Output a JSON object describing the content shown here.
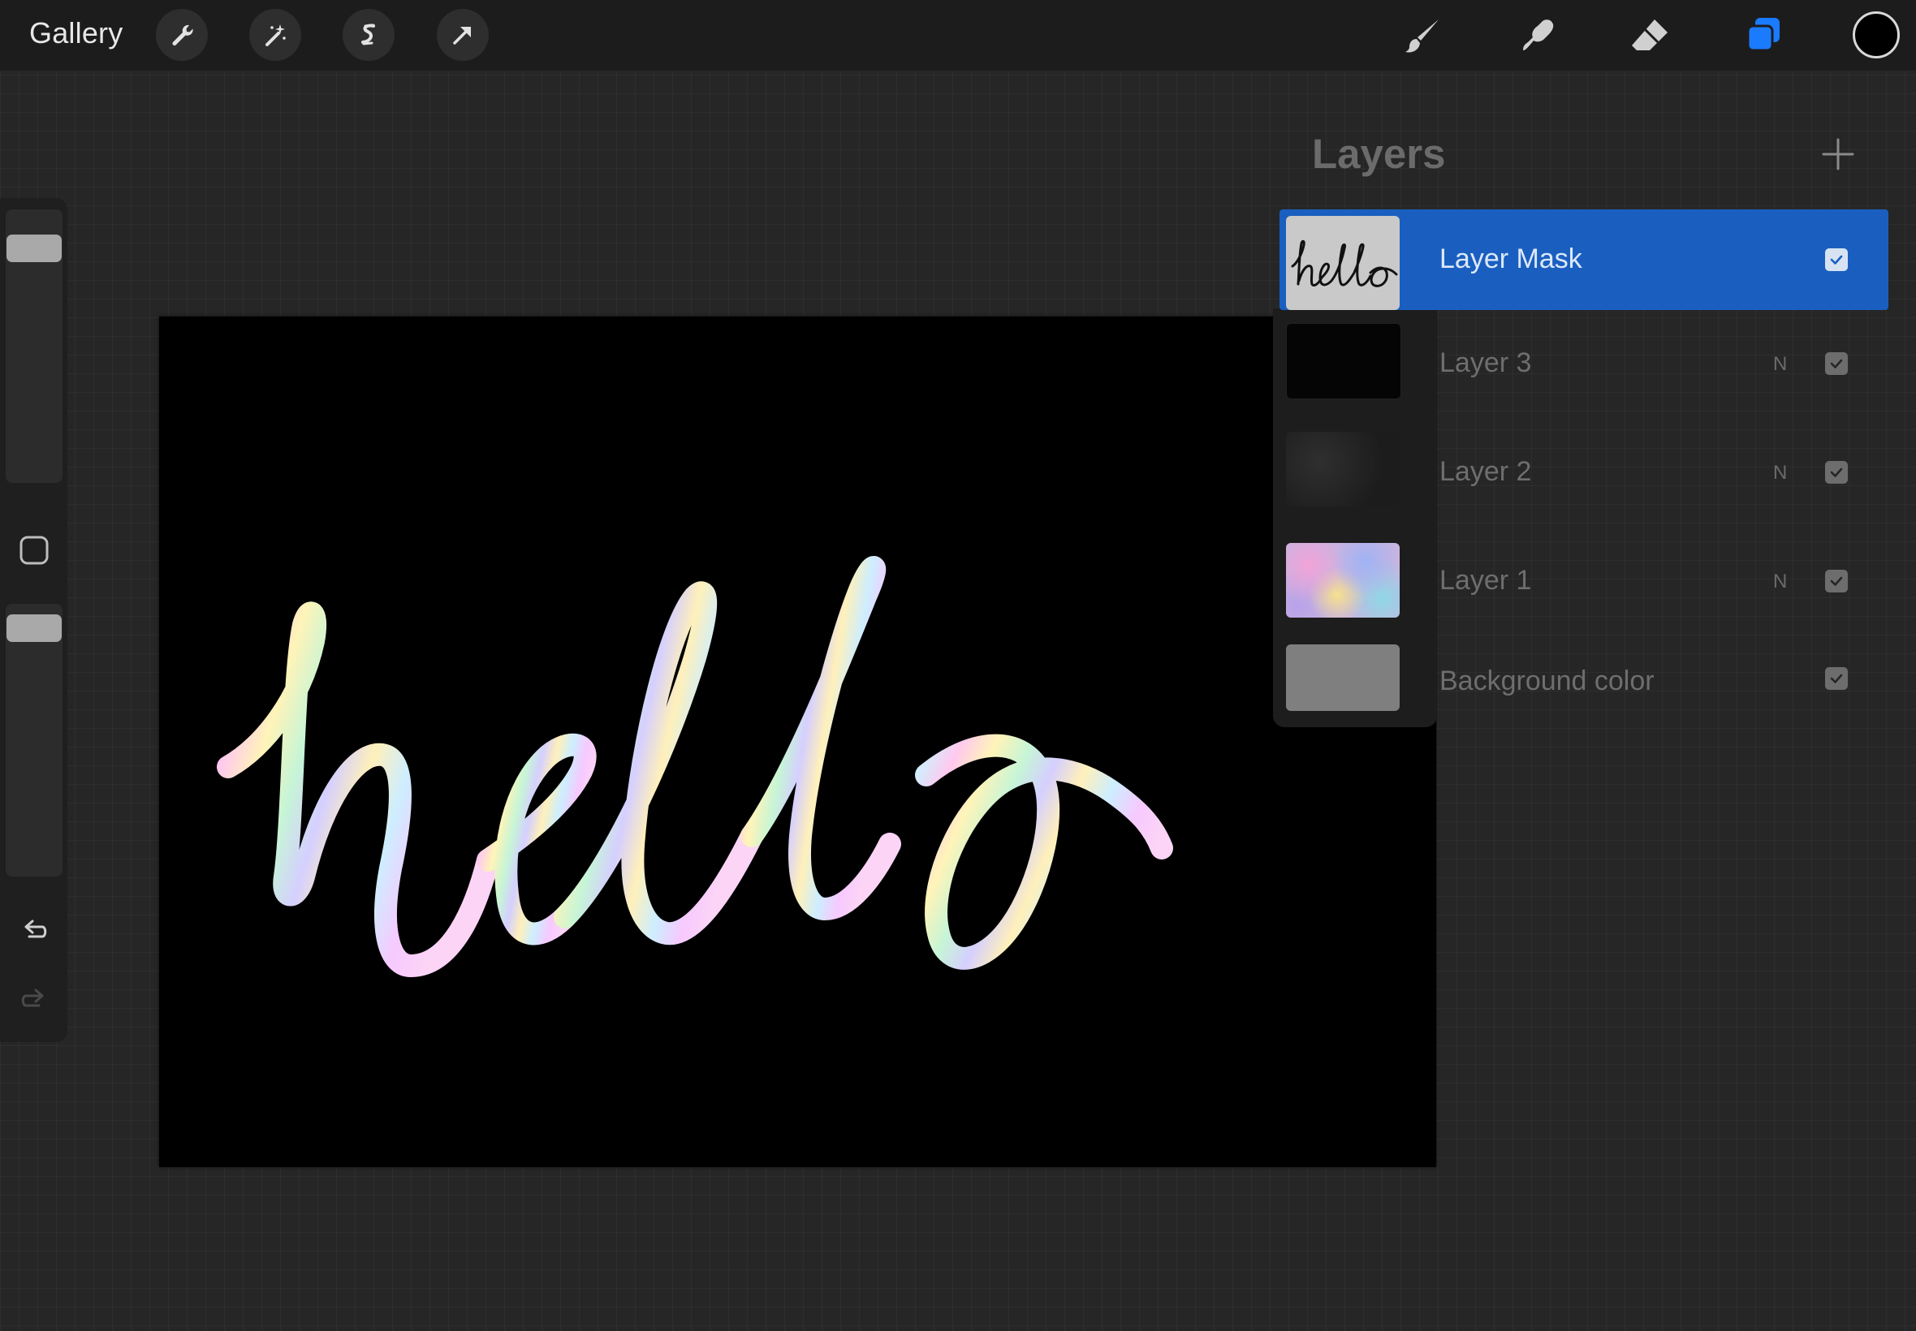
{
  "topbar": {
    "gallery_label": "Gallery",
    "left_tools": [
      "wrench-icon",
      "magic-wand-icon",
      "selection-icon",
      "transform-arrow-icon"
    ],
    "right_tools": [
      "brush-icon",
      "smudge-icon",
      "eraser-icon",
      "layers-icon"
    ],
    "active_tool": "layers-icon",
    "current_color": "#000000",
    "accent_color": "#1a7bff"
  },
  "sidebar": {
    "brush_size_level": 0.09,
    "opacity_level": 0.97,
    "icons": [
      "modify-square-icon",
      "undo-icon",
      "redo-icon"
    ]
  },
  "canvas": {
    "background": "#000000",
    "lettering": "hello"
  },
  "layers_panel": {
    "title": "Layers",
    "add_icon": "plus-icon",
    "layers": [
      {
        "name": "Layer Mask",
        "blend": "",
        "visible": true,
        "selected": true,
        "thumb": "hello-sketch"
      },
      {
        "name": "Layer 3",
        "blend": "N",
        "visible": true,
        "selected": false,
        "thumb": "black"
      },
      {
        "name": "Layer 2",
        "blend": "N",
        "visible": true,
        "selected": false,
        "thumb": "dark-texture"
      },
      {
        "name": "Layer 1",
        "blend": "N",
        "visible": true,
        "selected": false,
        "thumb": "holographic"
      },
      {
        "name": "Background color",
        "blend": "",
        "visible": true,
        "selected": false,
        "thumb": "gray"
      }
    ],
    "selected_color": "#1a5fc0"
  }
}
